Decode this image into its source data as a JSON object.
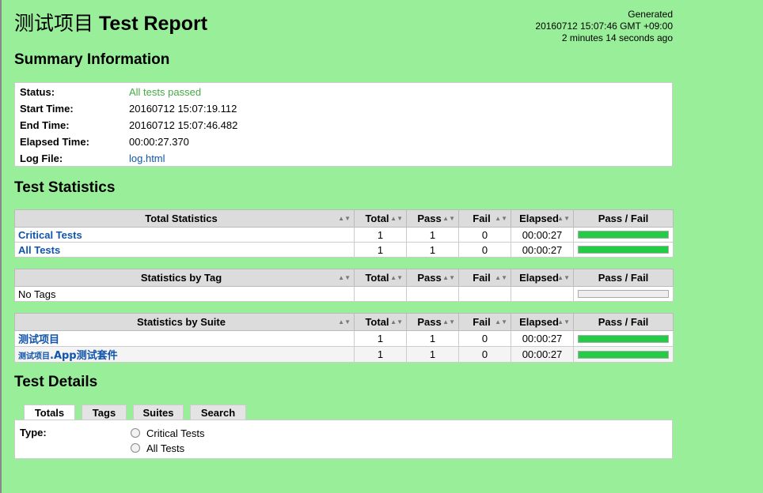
{
  "header": {
    "title_cn": "测试项目",
    "title_en": "Test Report",
    "generated_label": "Generated",
    "generated_time": "20160712 15:07:46 GMT +09:00",
    "generated_ago": "2 minutes 14 seconds ago"
  },
  "summary": {
    "heading": "Summary Information",
    "status_label": "Status:",
    "status_value": "All tests passed",
    "start_label": "Start Time:",
    "start_value": "20160712 15:07:19.112",
    "end_label": "End Time:",
    "end_value": "20160712 15:07:46.482",
    "elapsed_label": "Elapsed Time:",
    "elapsed_value": "00:00:27.370",
    "log_label": "Log File:",
    "log_value": "log.html"
  },
  "statistics": {
    "heading": "Test Statistics",
    "columns": {
      "total": "Total",
      "pass": "Pass",
      "fail": "Fail",
      "elapsed": "Elapsed",
      "passfail": "Pass / Fail"
    },
    "total_table": {
      "header": "Total Statistics",
      "rows": [
        {
          "name": "Critical Tests",
          "total": "1",
          "pass": "1",
          "fail": "0",
          "elapsed": "00:00:27",
          "pass_ratio": 1.0
        },
        {
          "name": "All Tests",
          "total": "1",
          "pass": "1",
          "fail": "0",
          "elapsed": "00:00:27",
          "pass_ratio": 1.0
        }
      ]
    },
    "tag_table": {
      "header": "Statistics by Tag",
      "empty_text": "No Tags"
    },
    "suite_table": {
      "header": "Statistics by Suite",
      "rows": [
        {
          "name": "测试项目",
          "total": "1",
          "pass": "1",
          "fail": "0",
          "elapsed": "00:00:27",
          "pass_ratio": 1.0
        },
        {
          "name_prefix": "测试项目",
          "name_suffix": ".App测试套件",
          "total": "1",
          "pass": "1",
          "fail": "0",
          "elapsed": "00:00:27",
          "pass_ratio": 1.0
        }
      ]
    }
  },
  "details": {
    "heading": "Test Details",
    "tabs": [
      "Totals",
      "Tags",
      "Suites",
      "Search"
    ],
    "type_label": "Type:",
    "options": [
      "Critical Tests",
      "All Tests"
    ]
  },
  "colors": {
    "background": "#99ee99",
    "pass_bar": "#22cc44",
    "link": "#1155aa",
    "pass_text": "#44aa44"
  }
}
